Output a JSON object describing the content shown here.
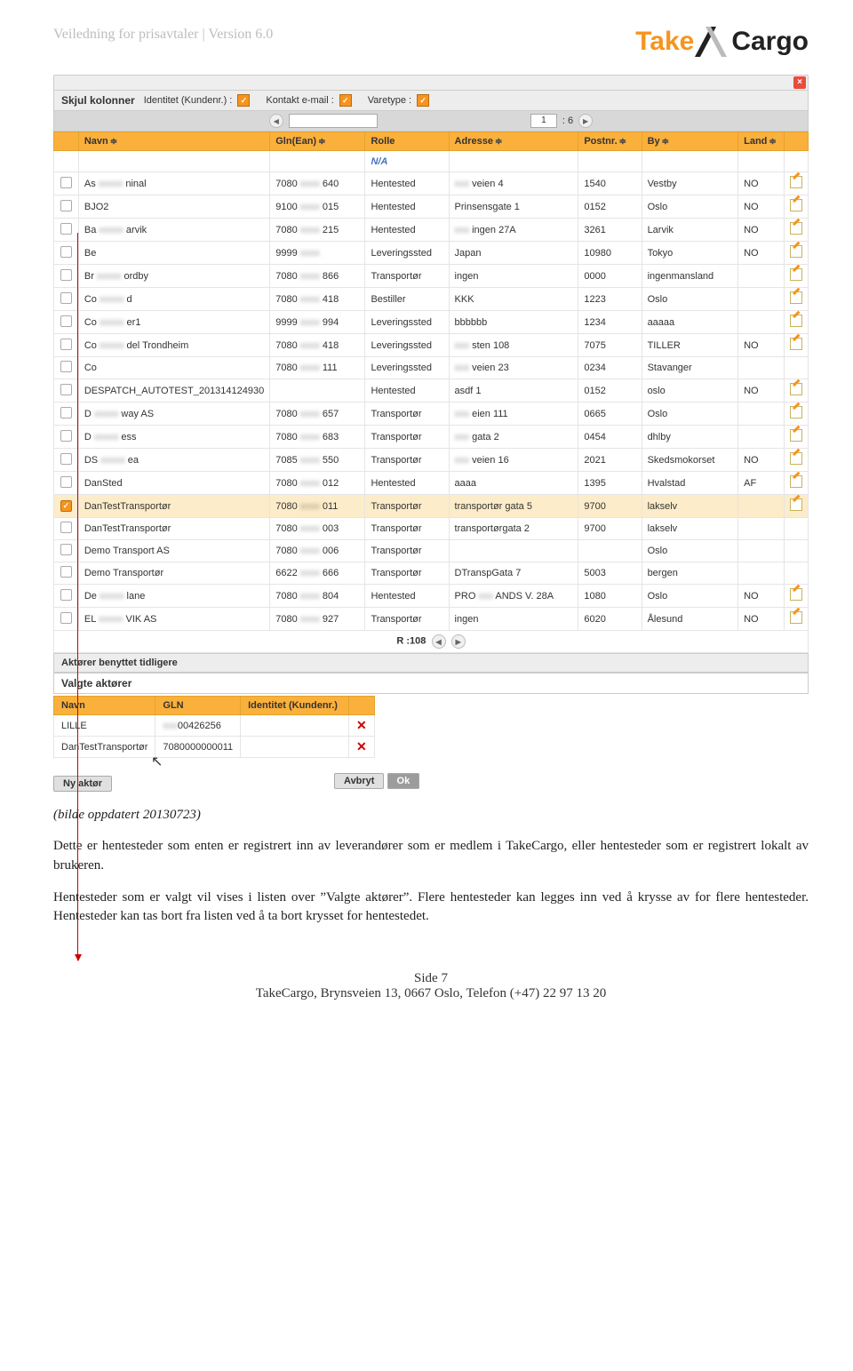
{
  "doc_header": {
    "title": "Veiledning for prisavtaler | Version 6.0"
  },
  "logo": {
    "part1": "Take",
    "part2": "Cargo"
  },
  "skjul": {
    "title": "Skjul kolonner",
    "items": [
      "Identitet (Kundenr.) :",
      "Kontakt e-mail :",
      "Varetype :"
    ]
  },
  "pager": {
    "page": "1",
    "of": ": 6"
  },
  "columns": [
    "",
    "Navn",
    "Gln(Ean)",
    "Rolle",
    "Adresse",
    "Postnr.",
    "By",
    "Land",
    ""
  ],
  "filter_na": "N/A",
  "rows": [
    {
      "chk": false,
      "navn_a": "As",
      "navn_b": "ninal",
      "gln_a": "7080",
      "gln_b": "640",
      "rolle": "Hentested",
      "adr_a": "",
      "adr_b": "veien 4",
      "post": "1540",
      "by": "Vestby",
      "land": "NO",
      "edit": true
    },
    {
      "chk": false,
      "navn_a": "BJO2",
      "navn_b": "",
      "gln_a": "9100",
      "gln_b": "015",
      "rolle": "Hentested",
      "adr_a": "Prinsensgate 1",
      "adr_b": "",
      "post": "0152",
      "by": "Oslo",
      "land": "NO",
      "edit": true
    },
    {
      "chk": false,
      "navn_a": "Ba",
      "navn_b": "arvik",
      "gln_a": "7080",
      "gln_b": "215",
      "rolle": "Hentested",
      "adr_a": "",
      "adr_b": "ingen 27A",
      "post": "3261",
      "by": "Larvik",
      "land": "NO",
      "edit": true
    },
    {
      "chk": false,
      "navn_a": "Be",
      "navn_b": "",
      "gln_a": "9999",
      "gln_b": "",
      "rolle": "Leveringssted",
      "adr_a": "Japan",
      "adr_b": "",
      "post": "10980",
      "by": "Tokyo",
      "land": "NO",
      "edit": true
    },
    {
      "chk": false,
      "navn_a": "Br",
      "navn_b": "ordby",
      "gln_a": "7080",
      "gln_b": "866",
      "rolle": "Transportør",
      "adr_a": "ingen",
      "adr_b": "",
      "post": "0000",
      "by": "ingenmansland",
      "land": "",
      "edit": true
    },
    {
      "chk": false,
      "navn_a": "Co",
      "navn_b": "d",
      "gln_a": "7080",
      "gln_b": "418",
      "rolle": "Bestiller",
      "adr_a": "KKK",
      "adr_b": "",
      "post": "1223",
      "by": "Oslo",
      "land": "",
      "edit": true
    },
    {
      "chk": false,
      "navn_a": "Co",
      "navn_b": "er1",
      "gln_a": "9999",
      "gln_b": "994",
      "rolle": "Leveringssted",
      "adr_a": "bbbbbb",
      "adr_b": "",
      "post": "1234",
      "by": "aaaaa",
      "land": "",
      "edit": true
    },
    {
      "chk": false,
      "navn_a": "Co",
      "navn_b": "del Trondheim",
      "gln_a": "7080",
      "gln_b": "418",
      "rolle": "Leveringssted",
      "adr_a": "",
      "adr_b": "sten 108",
      "post": "7075",
      "by": "TILLER",
      "land": "NO",
      "edit": true
    },
    {
      "chk": false,
      "navn_a": "Co",
      "navn_b": "",
      "gln_a": "7080",
      "gln_b": "111",
      "rolle": "Leveringssted",
      "adr_a": "",
      "adr_b": "veien 23",
      "post": "0234",
      "by": "Stavanger",
      "land": "",
      "edit": false
    },
    {
      "chk": false,
      "navn_a": "DESPATCH_AUTOTEST_201314124930",
      "navn_b": "",
      "gln_a": "",
      "gln_b": "",
      "rolle": "Hentested",
      "adr_a": "asdf 1",
      "adr_b": "",
      "post": "0152",
      "by": "oslo",
      "land": "NO",
      "edit": true
    },
    {
      "chk": false,
      "navn_a": "D",
      "navn_b": "way AS",
      "gln_a": "7080",
      "gln_b": "657",
      "rolle": "Transportør",
      "adr_a": "",
      "adr_b": "eien 111",
      "post": "0665",
      "by": "Oslo",
      "land": "",
      "edit": true
    },
    {
      "chk": false,
      "navn_a": "D",
      "navn_b": "ess",
      "gln_a": "7080",
      "gln_b": "683",
      "rolle": "Transportør",
      "adr_a": "",
      "adr_b": "gata 2",
      "post": "0454",
      "by": "dhlby",
      "land": "",
      "edit": true
    },
    {
      "chk": false,
      "navn_a": "DS",
      "navn_b": "ea",
      "gln_a": "7085",
      "gln_b": "550",
      "rolle": "Transportør",
      "adr_a": "",
      "adr_b": "veien 16",
      "post": "2021",
      "by": "Skedsmokorset",
      "land": "NO",
      "edit": true
    },
    {
      "chk": false,
      "navn_a": "DanSted",
      "navn_b": "",
      "gln_a": "7080",
      "gln_b": "012",
      "rolle": "Hentested",
      "adr_a": "aaaa",
      "adr_b": "",
      "post": "1395",
      "by": "Hvalstad",
      "land": "AF",
      "edit": true
    },
    {
      "chk": true,
      "navn_a": "DanTestTransportør",
      "navn_b": "",
      "gln_a": "7080",
      "gln_b": "011",
      "rolle": "Transportør",
      "adr_a": "transportør gata 5",
      "adr_b": "",
      "post": "9700",
      "by": "lakselv",
      "land": "",
      "edit": true
    },
    {
      "chk": false,
      "navn_a": "DanTestTransportør",
      "navn_b": "",
      "gln_a": "7080",
      "gln_b": "003",
      "rolle": "Transportør",
      "adr_a": "transportørgata 2",
      "adr_b": "",
      "post": "9700",
      "by": "lakselv",
      "land": "",
      "edit": false
    },
    {
      "chk": false,
      "navn_a": "Demo Transport AS",
      "navn_b": "",
      "gln_a": "7080",
      "gln_b": "006",
      "rolle": "Transportør",
      "adr_a": "",
      "adr_b": "",
      "post": "",
      "by": "Oslo",
      "land": "",
      "edit": false
    },
    {
      "chk": false,
      "navn_a": "Demo Transportør",
      "navn_b": "",
      "gln_a": "6622",
      "gln_b": "666",
      "rolle": "Transportør",
      "adr_a": "DTranspGata 7",
      "adr_b": "",
      "post": "5003",
      "by": "bergen",
      "land": "",
      "edit": false
    },
    {
      "chk": false,
      "navn_a": "De",
      "navn_b": "lane",
      "gln_a": "7080",
      "gln_b": "804",
      "rolle": "Hentested",
      "adr_a": "PRO",
      "adr_b": "ANDS V. 28A",
      "post": "1080",
      "by": "Oslo",
      "land": "NO",
      "edit": true
    },
    {
      "chk": false,
      "navn_a": "EL",
      "navn_b": "VIK AS",
      "gln_a": "7080",
      "gln_b": "927",
      "rolle": "Transportør",
      "adr_a": "ingen",
      "adr_b": "",
      "post": "6020",
      "by": "Ålesund",
      "land": "NO",
      "edit": true
    }
  ],
  "result_label": "R :108",
  "prev_section": "Aktører benyttet tidligere",
  "selected_section": "Valgte aktører",
  "selected_cols": [
    "Navn",
    "GLN",
    "Identitet (Kundenr.)"
  ],
  "selected_rows": [
    {
      "navn_a": "LILLE",
      "navn_b": "",
      "gln_a": "",
      "gln_b": "00426256",
      "ident": ""
    },
    {
      "navn_a": "DanTestTransportør",
      "navn_b": "",
      "gln_a": "7080000000011",
      "gln_b": "",
      "ident": ""
    }
  ],
  "buttons": {
    "new": "Ny aktør",
    "cancel": "Avbryt",
    "ok": "Ok"
  },
  "caption": "(bilde oppdatert 20130723)",
  "para1": "Dette er hentesteder som enten er registrert inn av leverandører som er medlem i TakeCargo, eller hentesteder som er registrert lokalt av brukeren.",
  "para2": "Hentesteder som er valgt vil vises i listen over ”Valgte aktører”.  Flere hentesteder kan legges inn ved å krysse av for flere hentesteder. Hentesteder kan tas bort fra listen ved å ta bort krysset for hentestedet.",
  "footer": {
    "page": "Side 7",
    "addr": "TakeCargo, Brynsveien 13, 0667 Oslo, Telefon (+47)  22 97 13 20"
  }
}
